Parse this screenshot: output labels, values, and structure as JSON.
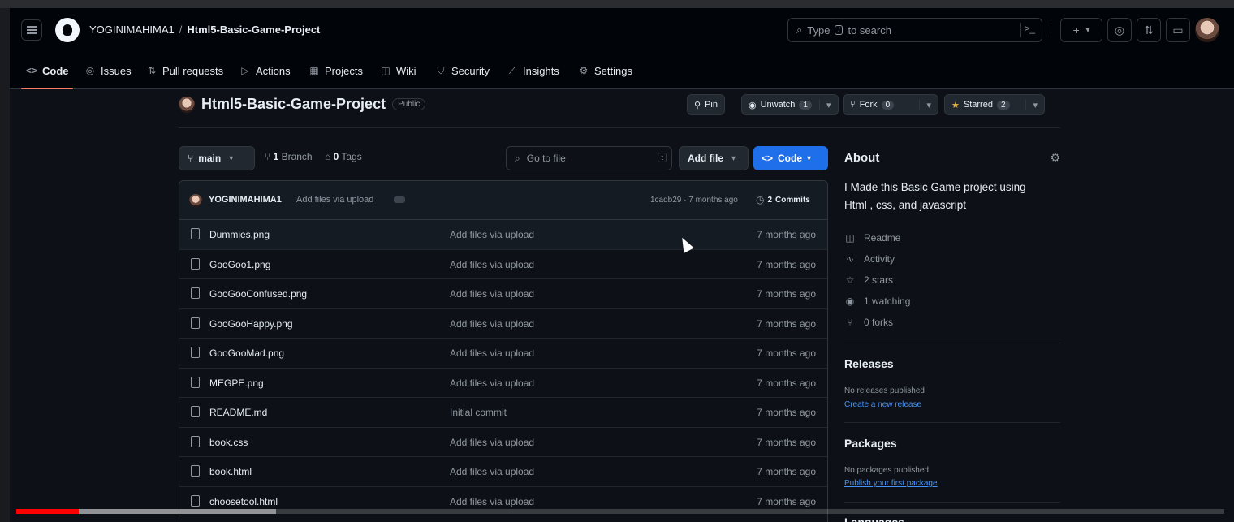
{
  "header": {
    "owner": "YOGINIMAHIMA1",
    "separator": "/",
    "repo": "Html5-Basic-Game-Project",
    "search_placeholder_prefix": "Type",
    "search_key": "/",
    "search_placeholder_suffix": "to search",
    "command_icon": ">_",
    "new_icon": "+",
    "caret": "▾"
  },
  "tabs": [
    {
      "label": "Code",
      "icon": "code-icon"
    },
    {
      "label": "Issues",
      "icon": "issue-icon"
    },
    {
      "label": "Pull requests",
      "icon": "pull-request-icon"
    },
    {
      "label": "Actions",
      "icon": "play-icon"
    },
    {
      "label": "Projects",
      "icon": "table-icon"
    },
    {
      "label": "Wiki",
      "icon": "book-icon"
    },
    {
      "label": "Security",
      "icon": "shield-icon"
    },
    {
      "label": "Insights",
      "icon": "graph-icon"
    },
    {
      "label": "Settings",
      "icon": "gear-icon"
    }
  ],
  "repo": {
    "name": "Html5-Basic-Game-Project",
    "visibility": "Public",
    "pin_label": "Pin",
    "unwatch_label": "Unwatch",
    "watch_count": "1",
    "fork_label": "Fork",
    "fork_count": "0",
    "starred_label": "Starred",
    "star_count": "2"
  },
  "toolbar": {
    "branch": "main",
    "branch_count": "1",
    "branch_label": "Branch",
    "tag_count": "0",
    "tag_label": "Tags",
    "goto_placeholder": "Go to file",
    "goto_key": "t",
    "add_file": "Add file",
    "code": "Code"
  },
  "latest_commit": {
    "author": "YOGINIMAHIMA1",
    "message": "Add files via upload",
    "sha_time": "1cadb29 · 7 months ago",
    "commits_count": "2",
    "commits_label": "Commits"
  },
  "files": [
    {
      "name": "Dummies.png",
      "message": "Add files via upload",
      "time": "7 months ago"
    },
    {
      "name": "GooGoo1.png",
      "message": "Add files via upload",
      "time": "7 months ago"
    },
    {
      "name": "GooGooConfused.png",
      "message": "Add files via upload",
      "time": "7 months ago"
    },
    {
      "name": "GooGooHappy.png",
      "message": "Add files via upload",
      "time": "7 months ago"
    },
    {
      "name": "GooGooMad.png",
      "message": "Add files via upload",
      "time": "7 months ago"
    },
    {
      "name": "MEGPE.png",
      "message": "Add files via upload",
      "time": "7 months ago"
    },
    {
      "name": "README.md",
      "message": "Initial commit",
      "time": "7 months ago"
    },
    {
      "name": "book.css",
      "message": "Add files via upload",
      "time": "7 months ago"
    },
    {
      "name": "book.html",
      "message": "Add files via upload",
      "time": "7 months ago"
    },
    {
      "name": "choosetool.html",
      "message": "Add files via upload",
      "time": "7 months ago"
    }
  ],
  "about": {
    "heading": "About",
    "description": "I Made this Basic Game project using Html , css, and javascript",
    "items": [
      {
        "label": "Readme",
        "icon": "book-icon"
      },
      {
        "label": "Activity",
        "icon": "pulse-icon"
      },
      {
        "label": "2 stars",
        "icon": "star-icon"
      },
      {
        "label": "1 watching",
        "icon": "eye-icon"
      },
      {
        "label": "0 forks",
        "icon": "fork-icon"
      }
    ]
  },
  "releases": {
    "heading": "Releases",
    "empty_text": "No releases published",
    "link": "Create a new release"
  },
  "packages": {
    "heading": "Packages",
    "empty_text": "No packages published",
    "link": "Publish your first package"
  },
  "languages": {
    "heading": "Languages"
  },
  "video_progress": {
    "played_fraction": 0.052,
    "buffered_fraction": 0.215
  },
  "colors": {
    "accent": "#1f6feb",
    "tab_underline": "#f78166",
    "link": "#4493f8",
    "star": "#e3b341",
    "progress": "#ff0000"
  }
}
